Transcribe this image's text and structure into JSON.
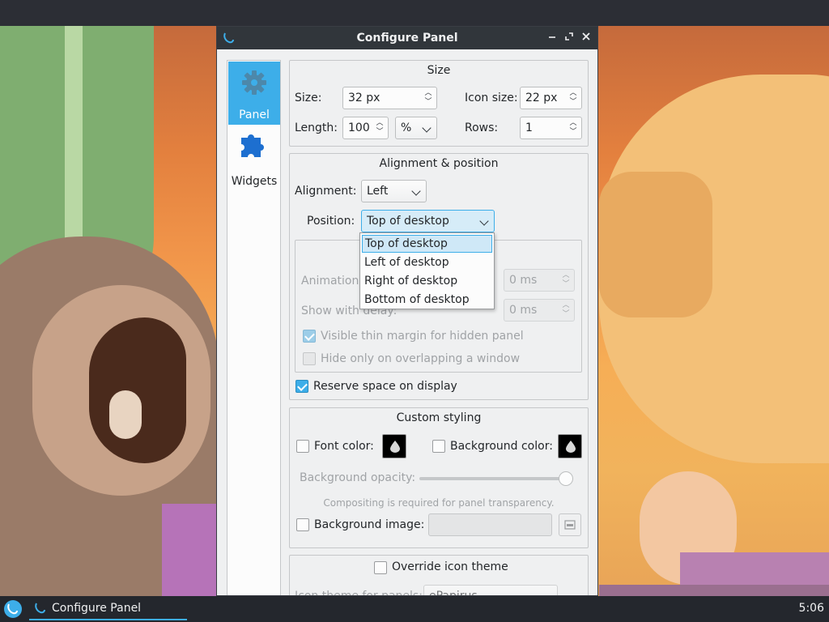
{
  "window": {
    "title": "Configure Panel"
  },
  "sidebar": {
    "items": [
      {
        "label": "Panel",
        "icon": "gear-icon",
        "active": true
      },
      {
        "label": "Widgets",
        "icon": "puzzle-icon",
        "active": false
      }
    ]
  },
  "size_group": {
    "title": "Size",
    "size_label": "Size:",
    "size_value": "32 px",
    "icon_size_label": "Icon size:",
    "icon_size_value": "22 px",
    "length_label": "Length:",
    "length_value": "100",
    "length_unit": "%",
    "rows_label": "Rows:",
    "rows_value": "1"
  },
  "alignment_group": {
    "title": "Alignment & position",
    "alignment_label": "Alignment:",
    "alignment_value": "Left",
    "position_label": "Position:",
    "position_value": "Top of desktop",
    "position_options": [
      "Top of desktop",
      "Left of desktop",
      "Right of desktop",
      "Bottom of desktop"
    ],
    "animation_label": "Animation",
    "animation_value": "0 ms",
    "show_delay_label": "Show with delay:",
    "show_delay_value": "0 ms",
    "thin_margin_label": "Visible thin margin for hidden panel",
    "hide_overlap_label": "Hide only on overlapping a window",
    "reserve_space_label": "Reserve space on display"
  },
  "styling_group": {
    "title": "Custom styling",
    "font_color_label": "Font color:",
    "bg_color_label": "Background color:",
    "bg_opacity_label": "Background opacity:",
    "bg_opacity": 1.0,
    "compositing_note": "Compositing is required for panel transparency.",
    "bg_image_label": "Background image:"
  },
  "icon_theme_group": {
    "override_label": "Override icon theme",
    "theme_label": "Icon theme for panels:",
    "theme_value": "ePapirus"
  },
  "taskbar": {
    "task_label": "Configure Panel",
    "clock": "5:06"
  },
  "colors": {
    "accent": "#3daee9",
    "titlebar": "#31363b",
    "window_bg": "#eff0f1",
    "taskbar": "#24272d"
  }
}
